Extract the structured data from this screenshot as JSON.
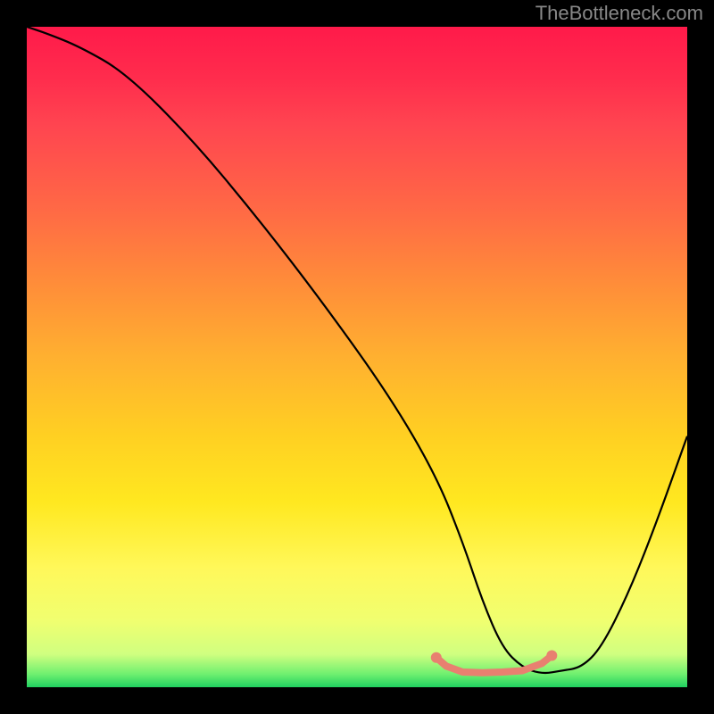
{
  "attribution": "TheBottleneck.com",
  "chart_data": {
    "type": "line",
    "title": "",
    "xlabel": "",
    "ylabel": "",
    "xlim": [
      0,
      100
    ],
    "ylim": [
      0,
      100
    ],
    "series": [
      {
        "name": "bottleneck-curve",
        "x": [
          0,
          3,
          8,
          15,
          25,
          35,
          45,
          55,
          62,
          66,
          69,
          72,
          75,
          78,
          81,
          84,
          87,
          91,
          95,
          100
        ],
        "values": [
          100,
          99,
          97,
          93,
          83,
          71,
          58,
          44,
          32,
          22,
          13,
          6,
          3,
          2,
          2.5,
          3,
          6,
          14,
          24,
          38
        ]
      }
    ],
    "markers": {
      "name": "highlight-segment",
      "color": "#e88070",
      "points": [
        {
          "x": 62,
          "y": 4.5
        },
        {
          "x": 63.5,
          "y": 3.2
        },
        {
          "x": 66,
          "y": 2.3
        },
        {
          "x": 69,
          "y": 2.2
        },
        {
          "x": 72,
          "y": 2.3
        },
        {
          "x": 75,
          "y": 2.5
        },
        {
          "x": 78,
          "y": 3.6
        },
        {
          "x": 79.5,
          "y": 4.8
        }
      ]
    },
    "background": {
      "type": "vertical-gradient",
      "stops": [
        {
          "pos": 0,
          "color": "#ff1a4a"
        },
        {
          "pos": 50,
          "color": "#ffb030"
        },
        {
          "pos": 85,
          "color": "#fcff60"
        },
        {
          "pos": 100,
          "color": "#20d060"
        }
      ]
    }
  }
}
